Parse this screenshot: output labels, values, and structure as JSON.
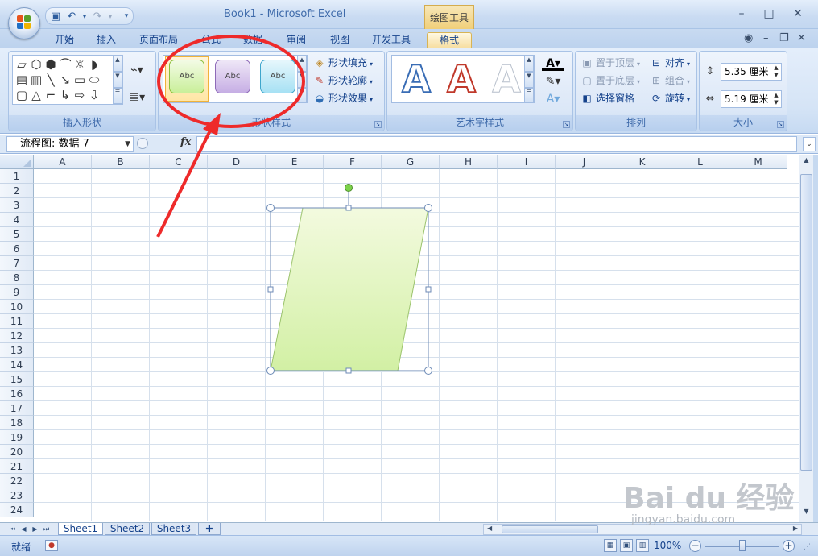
{
  "window": {
    "title": "Book1 - Microsoft Excel",
    "context_tab_header": "绘图工具"
  },
  "tabs": [
    "开始",
    "插入",
    "页面布局",
    "公式",
    "数据",
    "审阅",
    "视图",
    "开发工具",
    "格式"
  ],
  "active_tab": "格式",
  "ribbon": {
    "insert_shapes": {
      "label": "插入形状"
    },
    "shape_styles": {
      "label": "形状样式",
      "gallery": [
        "Abc",
        "Abc",
        "Abc"
      ],
      "fill": "形状填充",
      "outline": "形状轮廓",
      "effects": "形状效果"
    },
    "wordart_styles": {
      "label": "艺术字样式",
      "letters": [
        "A",
        "A",
        "A"
      ]
    },
    "arrange": {
      "label": "排列",
      "bring_front": "置于顶层",
      "send_back": "置于底层",
      "selection_pane": "选择窗格",
      "align": "对齐",
      "group": "组合",
      "rotate": "旋转"
    },
    "size": {
      "label": "大小",
      "height": "5.35 厘米",
      "width": "5.19 厘米"
    }
  },
  "formula_bar": {
    "name_box": "流程图: 数据 7",
    "fx": "fx",
    "formula": ""
  },
  "grid": {
    "columns": [
      "A",
      "B",
      "C",
      "D",
      "E",
      "F",
      "G",
      "H",
      "I",
      "J",
      "K",
      "L",
      "M"
    ],
    "rows": [
      "1",
      "2",
      "3",
      "4",
      "5",
      "6",
      "7",
      "8",
      "9",
      "10",
      "11",
      "12",
      "13",
      "14",
      "15",
      "16",
      "17",
      "18",
      "19",
      "20",
      "21",
      "22",
      "23",
      "24"
    ]
  },
  "sheets": [
    "Sheet1",
    "Sheet2",
    "Sheet3"
  ],
  "active_sheet": "Sheet1",
  "status": {
    "ready": "就绪",
    "zoom": "100%"
  },
  "watermark": {
    "brand": "Bai du 经验",
    "url": "jingyan.baidu.com"
  },
  "colors": {
    "accent": "#15428b",
    "shape_fill_top": "#f3fadf",
    "shape_fill_bottom": "#d2f0a4",
    "annotation": "#ee2a2a"
  }
}
